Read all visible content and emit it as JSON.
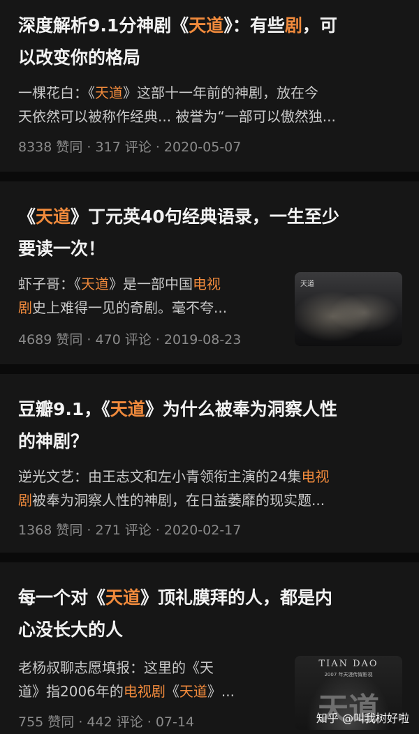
{
  "cards": [
    {
      "title": [
        [
          {
            "t": "深度解析9.1分神剧《"
          },
          {
            "t": "天道",
            "hl": true
          },
          {
            "t": "》：有些"
          },
          {
            "t": "剧",
            "hl": true
          },
          {
            "t": "，可"
          }
        ],
        [
          {
            "t": "以改变你的格局"
          }
        ]
      ],
      "excerpt": [
        [
          {
            "t": "一棵花白：《"
          },
          {
            "t": "天道",
            "hl": true
          },
          {
            "t": "》这部十一年前的神剧，放在今"
          }
        ],
        [
          {
            "t": "天依然可以被称作经典... 被誉为“一部可以傲然独..."
          }
        ]
      ],
      "meta": "8338 赞同 · 317 评论 · 2020-05-07"
    },
    {
      "title": [
        [
          {
            "t": "《"
          },
          {
            "t": "天道",
            "hl": true
          },
          {
            "t": "》丁元英40句经典语录，一生至少"
          }
        ],
        [
          {
            "t": "要读一次！"
          }
        ]
      ],
      "excerpt": [
        [
          {
            "t": "虾子哥：《"
          },
          {
            "t": "天道",
            "hl": true
          },
          {
            "t": "》是一部中国"
          },
          {
            "t": "电视",
            "hl": true
          }
        ],
        [
          {
            "t": "剧",
            "hl": true
          },
          {
            "t": "史上难得一见的奇剧。毫不夸..."
          }
        ]
      ],
      "meta": "4689 赞同 · 470 评论 · 2019-08-23",
      "thumb_text": "天道"
    },
    {
      "title": [
        [
          {
            "t": "豆瓣9.1，《"
          },
          {
            "t": "天道",
            "hl": true
          },
          {
            "t": "》为什么被奉为洞察人性"
          }
        ],
        [
          {
            "t": "的神剧？"
          }
        ]
      ],
      "excerpt": [
        [
          {
            "t": "逆光文艺：由王志文和左小青领衔主演的24集"
          },
          {
            "t": "电视",
            "hl": true
          }
        ],
        [
          {
            "t": "剧",
            "hl": true
          },
          {
            "t": "被奉为洞察人性的神剧，在日益萎靡的现实题..."
          }
        ]
      ],
      "meta": "1368 赞同 · 271 评论 · 2020-02-17"
    },
    {
      "title": [
        [
          {
            "t": "每一个对《"
          },
          {
            "t": "天道",
            "hl": true
          },
          {
            "t": "》顶礼膜拜的人，都是内"
          }
        ],
        [
          {
            "t": "心没长大的人"
          }
        ]
      ],
      "excerpt": [
        [
          {
            "t": "老杨叔聊志愿填报：这里的《天"
          }
        ],
        [
          {
            "t": "道》指2006年的"
          },
          {
            "t": "电视剧",
            "hl": true
          },
          {
            "t": "《"
          },
          {
            "t": "天道",
            "hl": true
          },
          {
            "t": "》..."
          }
        ]
      ],
      "meta": "755 赞同 · 442 评论 · 07-14",
      "thumb_text": "TIAN DAO",
      "thumb_sub": "2007 年天涯传媒影视",
      "thumb_big": "天道"
    }
  ],
  "watermark": "知乎 @叫我树好啦",
  "colors": {
    "highlight": "#f08a3c",
    "background": "#0b0b0b",
    "card": "#161616",
    "meta": "#8a8a8a"
  }
}
